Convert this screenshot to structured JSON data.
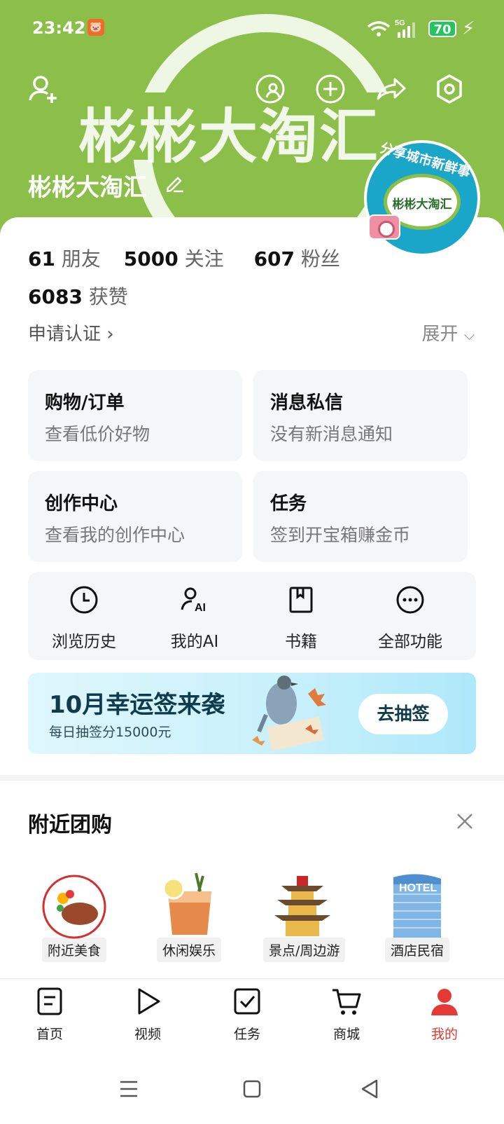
{
  "status_bar": {
    "time": "23:42",
    "app_badge": "🐷",
    "network": "5G",
    "battery": "70"
  },
  "cover": {
    "big_text": "彬彬大淘汇",
    "username": "彬彬大淘汇",
    "badge": {
      "arc_text": "分享城市新鲜事",
      "name": "彬彬大淘汇"
    }
  },
  "stats": {
    "friends_count": "61",
    "friends_label": "朋友",
    "following_count": "5000",
    "following_label": "关注",
    "fans_count": "607",
    "fans_label": "粉丝",
    "likes_count": "6083",
    "likes_label": "获赞"
  },
  "links": {
    "verify": "申请认证",
    "expand": "展开"
  },
  "cards": [
    {
      "title": "购物/订单",
      "subtitle": "查看低价好物"
    },
    {
      "title": "消息私信",
      "subtitle": "没有新消息通知"
    },
    {
      "title": "创作中心",
      "subtitle": "查看我的创作中心"
    },
    {
      "title": "任务",
      "subtitle": "签到开宝箱赚金币"
    }
  ],
  "tools": [
    {
      "label": "浏览历史",
      "icon": "clock-icon"
    },
    {
      "label": "我的AI",
      "icon": "ai-person-icon"
    },
    {
      "label": "书籍",
      "icon": "book-icon"
    },
    {
      "label": "全部功能",
      "icon": "more-icon"
    }
  ],
  "banner": {
    "title": "10月幸运签来袭",
    "subtitle": "每日抽签分15000元",
    "button": "去抽签"
  },
  "nearby": {
    "title": "附近团购",
    "categories": [
      {
        "label": "附近美食",
        "icon": "food-plate-icon"
      },
      {
        "label": "休闲娱乐",
        "icon": "cocktail-icon"
      },
      {
        "label": "景点/周边游",
        "icon": "pagoda-icon"
      },
      {
        "label": "酒店民宿",
        "icon": "hotel-building-icon"
      }
    ],
    "hotel_sign": "HOTEL"
  },
  "bottom_nav": [
    {
      "label": "首页",
      "icon": "home-icon"
    },
    {
      "label": "视频",
      "icon": "play-icon"
    },
    {
      "label": "任务",
      "icon": "task-check-icon"
    },
    {
      "label": "商城",
      "icon": "cart-icon"
    },
    {
      "label": "我的",
      "icon": "profile-icon",
      "active": true
    }
  ],
  "colors": {
    "cover_green": "#8cbf4a",
    "accent_red": "#e53935",
    "badge_blue": "#1aa6c9"
  }
}
